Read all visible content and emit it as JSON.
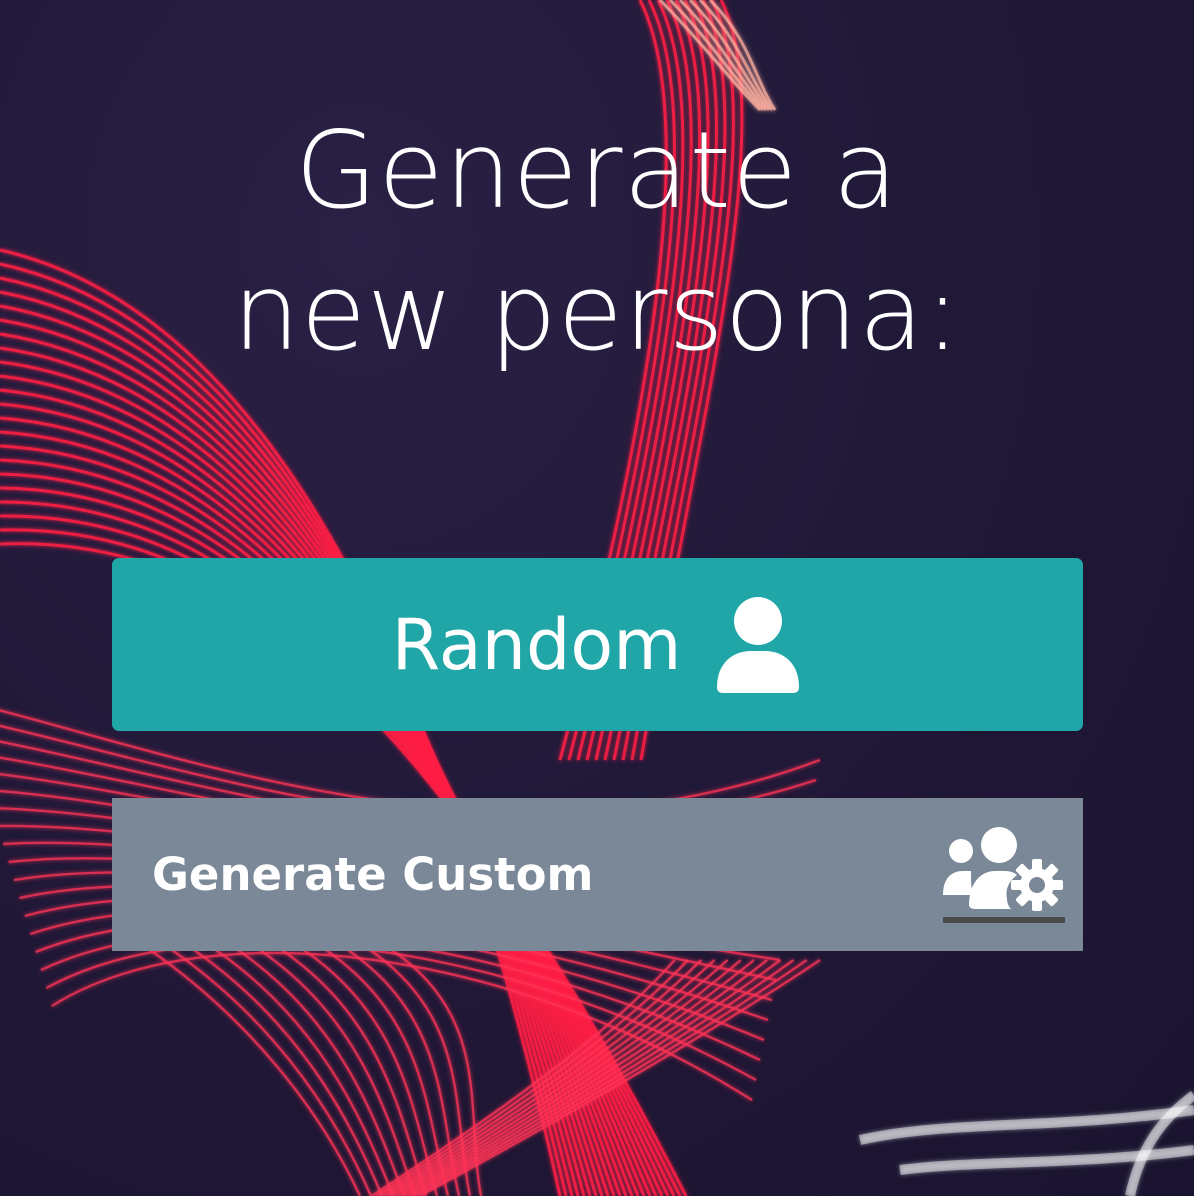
{
  "heading": {
    "line1": "Generate a",
    "line2": "new persona:"
  },
  "random_button": {
    "label": "Random",
    "icon": "user-icon",
    "color": "#21a6a8"
  },
  "custom_button": {
    "label": "Generate Custom",
    "icon": "users-gear-icon",
    "color": "#7b8898"
  },
  "background": {
    "base_color": "#231a3a",
    "accent_color": "#ff2a4a"
  }
}
